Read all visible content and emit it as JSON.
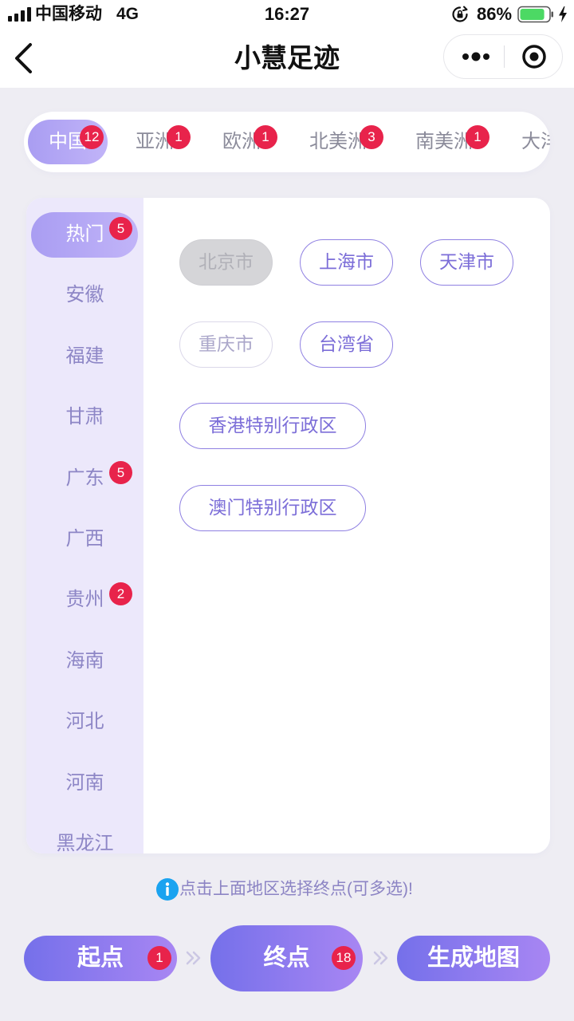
{
  "status_bar": {
    "carrier": "中国移动",
    "network": "4G",
    "time": "16:27",
    "battery": "86%",
    "battery_level": 86
  },
  "nav": {
    "title": "小慧足迹"
  },
  "icons": {
    "signal": "signal-bars-icon",
    "rotation_lock": "rotation-lock-icon",
    "battery": "battery-icon",
    "charging": "charging-bolt-icon",
    "back": "back-chevron-icon",
    "more": "more-dots-icon",
    "close": "target-circle-icon",
    "info": "info-icon",
    "step": "double-chevron-right-icon"
  },
  "continent_tabs": [
    {
      "label": "中国",
      "badge": "12",
      "selected": true
    },
    {
      "label": "亚洲",
      "badge": "1"
    },
    {
      "label": "欧洲",
      "badge": "1"
    },
    {
      "label": "北美洲",
      "badge": "3"
    },
    {
      "label": "南美洲",
      "badge": "1"
    },
    {
      "label": "大洋"
    }
  ],
  "provinces": [
    {
      "label": "热门",
      "badge": "5",
      "selected": true
    },
    {
      "label": "安徽"
    },
    {
      "label": "福建"
    },
    {
      "label": "甘肃"
    },
    {
      "label": "广东",
      "badge": "5"
    },
    {
      "label": "广西"
    },
    {
      "label": "贵州",
      "badge": "2"
    },
    {
      "label": "海南"
    },
    {
      "label": "河北"
    },
    {
      "label": "河南"
    },
    {
      "label": "黑龙江"
    }
  ],
  "cities": [
    {
      "label": "北京市",
      "disabled": true
    },
    {
      "label": "上海市"
    },
    {
      "label": "天津市"
    },
    {
      "label": "重庆市",
      "muted": true
    },
    {
      "label": "台湾省"
    },
    {
      "label": "香港特别行政区"
    },
    {
      "label": "澳门特别行政区"
    }
  ],
  "hint": "点击上面地区选择终点(可多选)!",
  "actions": {
    "start": {
      "label": "起点",
      "badge": "1"
    },
    "end": {
      "label": "终点",
      "badge": "18"
    },
    "generate": {
      "label": "生成地图"
    }
  },
  "colors": {
    "accent": "#7c6ed8",
    "accent_border": "#8f80e2",
    "button_gradient_start": "#7570ea",
    "button_gradient_end": "#a886f3",
    "selected_pill_start": "#a99df2",
    "selected_pill_end": "#c1b4f8",
    "badge": "#e8234b",
    "sidebar_bg": "#ece8fb",
    "sidebar_text": "#8d86c6",
    "page_bg": "#eeedf3",
    "info": "#1aa3f0",
    "battery_green": "#4cd964"
  }
}
